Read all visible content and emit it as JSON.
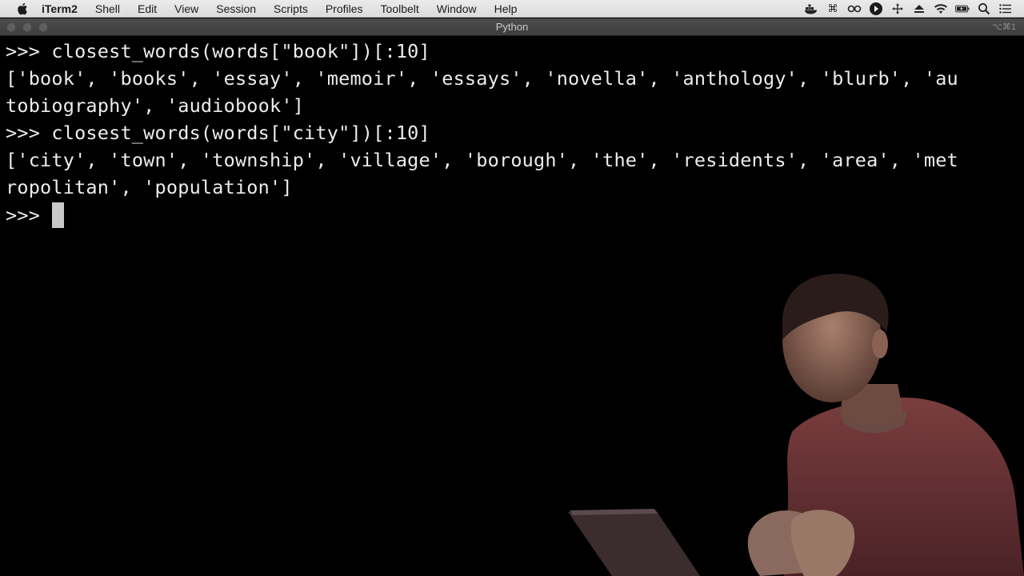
{
  "menubar": {
    "app_name": "iTerm2",
    "items": [
      "Shell",
      "Edit",
      "View",
      "Session",
      "Scripts",
      "Profiles",
      "Toolbelt",
      "Window",
      "Help"
    ],
    "status_icons": [
      "docker-icon",
      "command-key-icon",
      "link-icon",
      "play-icon",
      "move-icon",
      "eject-icon",
      "wifi-icon",
      "battery-icon",
      "search-icon",
      "menu-icon"
    ]
  },
  "window": {
    "title": "Python",
    "shortcut": "⌥⌘1"
  },
  "terminal": {
    "lines": [
      ">>> closest_words(words[\"book\"])[:10]",
      "['book', 'books', 'essay', 'memoir', 'essays', 'novella', 'anthology', 'blurb', 'au",
      "tobiography', 'audiobook']",
      ">>> closest_words(words[\"city\"])[:10]",
      "['city', 'town', 'township', 'village', 'borough', 'the', 'residents', 'area', 'met",
      "ropolitan', 'population']",
      ">>> "
    ]
  },
  "colors": {
    "terminal_bg": "#000000",
    "terminal_fg": "#ececec",
    "menubar_bg": "#e5e4e5",
    "titlebar_bg": "#454545"
  }
}
